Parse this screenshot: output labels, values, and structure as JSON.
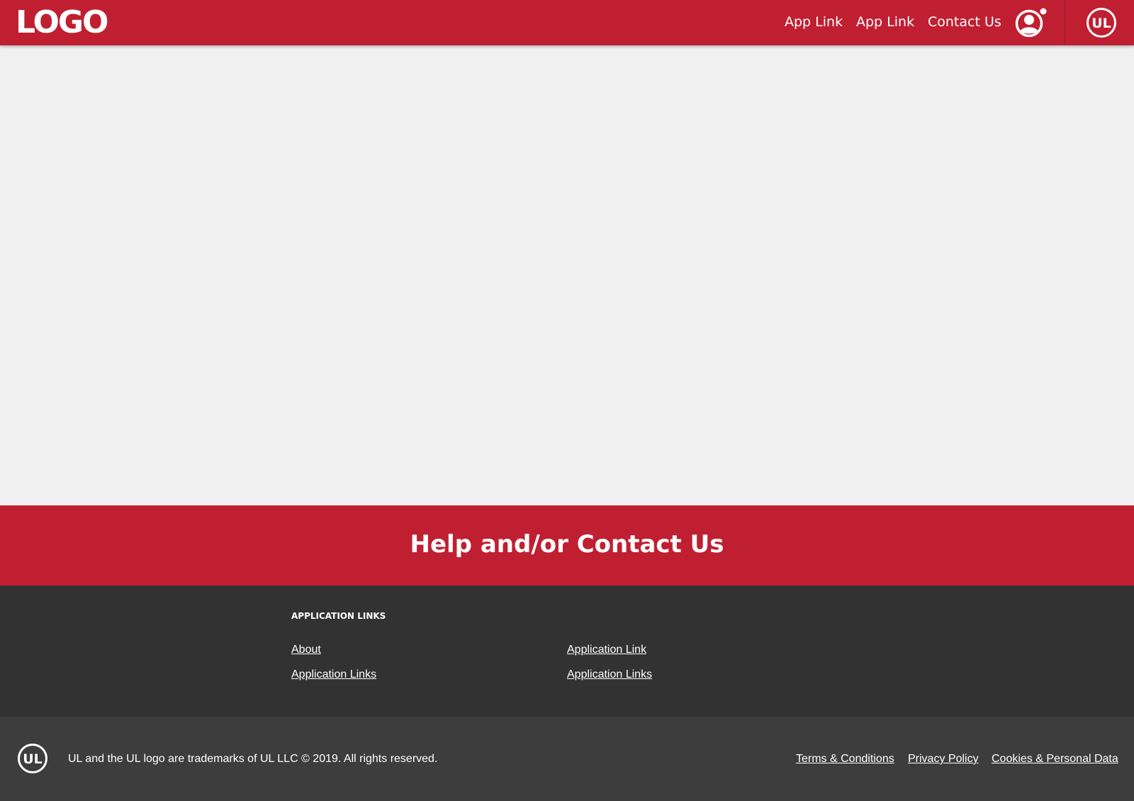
{
  "header": {
    "logo": "LOGO",
    "nav": [
      {
        "label": "App Link"
      },
      {
        "label": "App Link"
      },
      {
        "label": "Contact Us"
      }
    ],
    "icons": {
      "user": "user-profile-icon",
      "notification": "notification-dot",
      "brand": "ul-logo-icon"
    },
    "brand_mark": "UL"
  },
  "help_banner": {
    "title": "Help and/or Contact Us"
  },
  "footer_links": {
    "heading": "APPLICATION LINKS",
    "column1": [
      "About",
      "Application Links"
    ],
    "column2": [
      "Application Link",
      "Application Links"
    ]
  },
  "bottom_footer": {
    "brand_mark": "UL",
    "copyright": "UL and the UL logo are trademarks of UL LLC © 2019. All rights reserved.",
    "legal_links": [
      "Terms & Conditions",
      "Privacy Policy",
      "Cookies & Personal Data"
    ]
  },
  "colors": {
    "brand_red": "#c01f32",
    "content_bg": "#f0f0f0",
    "footer_dark": "#323232",
    "footer_darker": "#3d3d3d",
    "text_light": "#ffffff"
  }
}
